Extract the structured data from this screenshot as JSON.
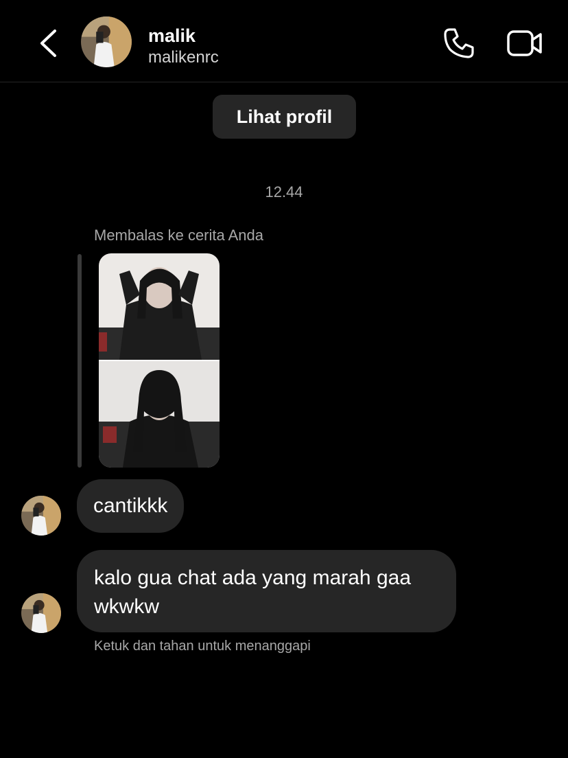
{
  "header": {
    "name": "malik",
    "username": "malikenrc",
    "icons": {
      "back": "chevron-left-icon",
      "call": "phone-icon",
      "video": "video-camera-icon"
    }
  },
  "profile_button": {
    "label": "Lihat profil"
  },
  "conversation": {
    "timestamp": "12.44",
    "reply_label": "Membalas ke cerita Anda",
    "messages": [
      {
        "text": "cantikkk"
      },
      {
        "text": "kalo gua chat ada yang marah gaa wkwkw"
      }
    ],
    "hint": "Ketuk dan tahan untuk menanggapi"
  },
  "colors": {
    "background": "#000000",
    "bubble": "#262626",
    "secondary_text": "#a8a8a8"
  }
}
